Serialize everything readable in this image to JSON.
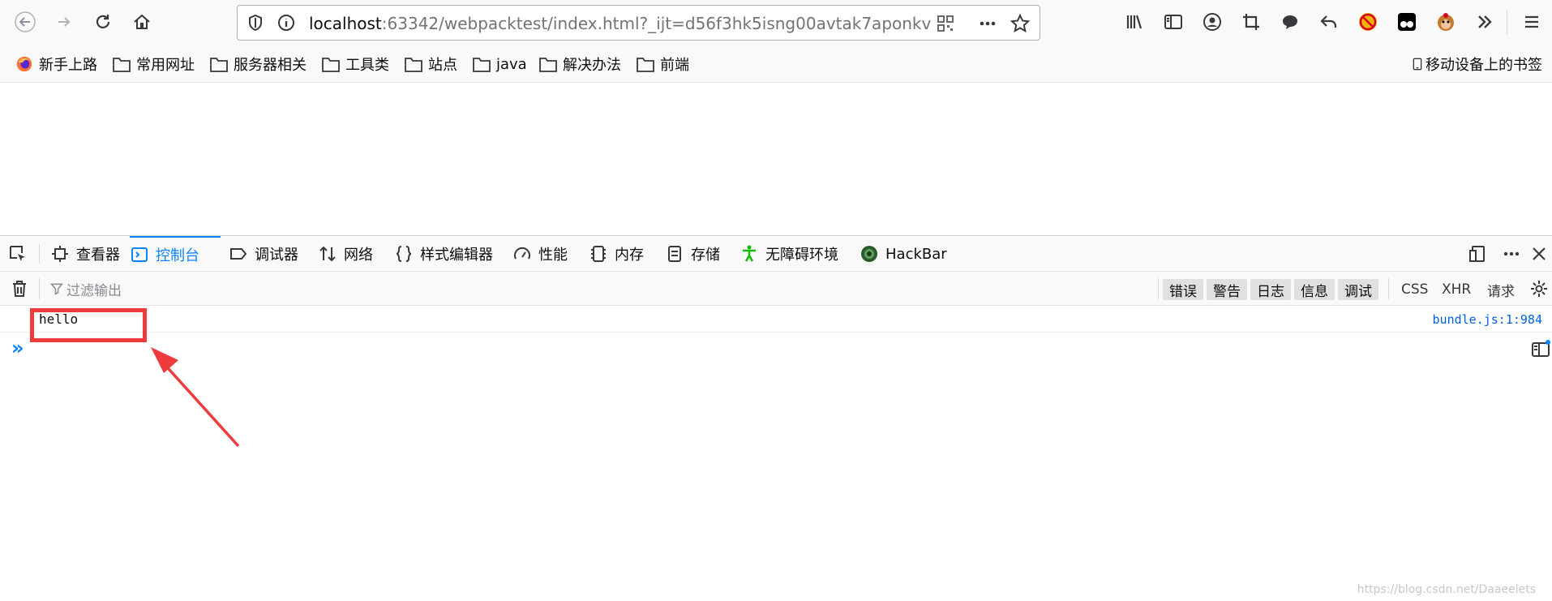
{
  "browser": {
    "url_host": "localhost",
    "url_rest": ":63342/webpacktest/index.html?_ijt=d56f3hk5isng00avtak7aponkv",
    "bookmarks": [
      {
        "label": "新手上路",
        "icon": "firefox-icon"
      },
      {
        "label": "常用网址",
        "icon": "folder-icon"
      },
      {
        "label": "服务器相关",
        "icon": "folder-icon"
      },
      {
        "label": "工具类",
        "icon": "folder-icon"
      },
      {
        "label": "站点",
        "icon": "folder-icon"
      },
      {
        "label": "java",
        "icon": "folder-icon"
      },
      {
        "label": "解决办法",
        "icon": "folder-icon"
      },
      {
        "label": "前端",
        "icon": "folder-icon"
      }
    ],
    "mobile_bookmarks": "移动设备上的书签"
  },
  "devtools": {
    "tabs": [
      {
        "label": "查看器",
        "icon": "inspector-icon"
      },
      {
        "label": "控制台",
        "icon": "console-icon",
        "active": true
      },
      {
        "label": "调试器",
        "icon": "debugger-icon"
      },
      {
        "label": "网络",
        "icon": "network-icon"
      },
      {
        "label": "样式编辑器",
        "icon": "braces-icon"
      },
      {
        "label": "性能",
        "icon": "gauge-icon"
      },
      {
        "label": "内存",
        "icon": "memory-icon"
      },
      {
        "label": "存储",
        "icon": "storage-icon"
      },
      {
        "label": "无障碍环境",
        "icon": "accessibility-icon"
      },
      {
        "label": "HackBar",
        "icon": "hackbar-icon"
      }
    ],
    "filter_placeholder": "过滤输出",
    "levels": [
      "错误",
      "警告",
      "日志",
      "信息",
      "调试"
    ],
    "extra_filters": [
      "CSS",
      "XHR",
      "请求"
    ],
    "log": {
      "message": "hello",
      "source": "bundle.js:1:984"
    },
    "prompt_symbol": "»"
  },
  "watermark": "https://blog.csdn.net/Daaeelets",
  "colors": {
    "accent": "#0a84ff",
    "annotation": "#ee3b3b"
  }
}
